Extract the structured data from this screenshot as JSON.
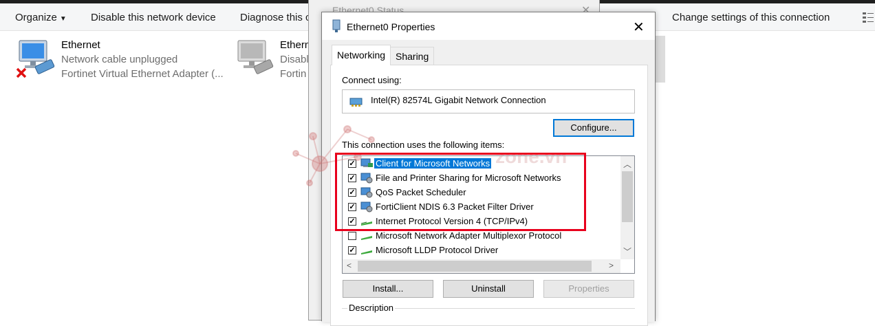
{
  "commandbar": {
    "organize": "Organize",
    "disable": "Disable this network device",
    "diagnose": "Diagnose this c",
    "change_settings": "Change settings of this connection"
  },
  "adapters": [
    {
      "name": "Ethernet",
      "status": "Network cable unplugged",
      "device": "Fortinet Virtual Ethernet Adapter (..."
    },
    {
      "name": "Ethern",
      "status": "Disabl",
      "device": "Fortin"
    }
  ],
  "status_window": {
    "title": "Ethernet0 Status"
  },
  "dialog": {
    "title": "Ethernet0 Properties",
    "tabs": [
      "Networking",
      "Sharing"
    ],
    "connect_using_label": "Connect using:",
    "adapter_name": "Intel(R) 82574L Gigabit Network Connection",
    "configure_label": "Configure...",
    "items_label": "This connection uses the following items:",
    "items": [
      {
        "label": "Client for Microsoft Networks",
        "checked": true,
        "selected": true,
        "icon": "network-client-icon"
      },
      {
        "label": "File and Printer Sharing for Microsoft Networks",
        "checked": true,
        "selected": false,
        "icon": "network-service-icon"
      },
      {
        "label": "QoS Packet Scheduler",
        "checked": true,
        "selected": false,
        "icon": "network-service-icon"
      },
      {
        "label": "FortiClient NDIS 6.3 Packet Filter Driver",
        "checked": true,
        "selected": false,
        "icon": "network-service-icon"
      },
      {
        "label": "Internet Protocol Version 4 (TCP/IPv4)",
        "checked": true,
        "selected": false,
        "icon": "protocol-icon"
      },
      {
        "label": "Microsoft Network Adapter Multiplexor Protocol",
        "checked": false,
        "selected": false,
        "icon": "protocol-icon"
      },
      {
        "label": "Microsoft LLDP Protocol Driver",
        "checked": true,
        "selected": false,
        "icon": "protocol-icon"
      }
    ],
    "install_label": "Install...",
    "uninstall_label": "Uninstall",
    "properties_label": "Properties",
    "description_label": "Description"
  },
  "watermark": {
    "text": "zone.vn"
  },
  "colors": {
    "highlight": "#0078d7",
    "annotation": "#e8001c"
  }
}
